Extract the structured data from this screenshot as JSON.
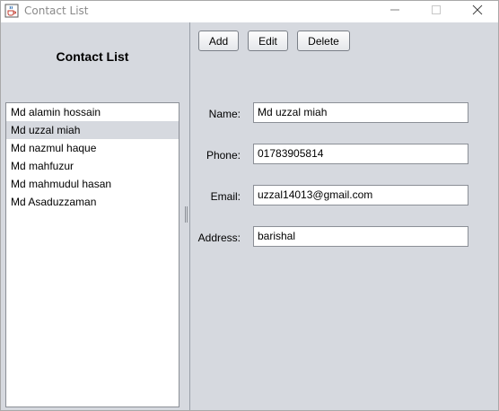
{
  "window": {
    "title": "Contact List"
  },
  "left": {
    "heading": "Contact List",
    "contacts": [
      "Md alamin hossain",
      "Md uzzal miah",
      "Md nazmul haque",
      "Md mahfuzur",
      "Md mahmudul hasan",
      "Md Asaduzzaman"
    ],
    "selected_index": 1
  },
  "toolbar": {
    "add_label": "Add",
    "edit_label": "Edit",
    "delete_label": "Delete"
  },
  "form": {
    "name_label": "Name:",
    "name_value": "Md uzzal miah",
    "phone_label": "Phone:",
    "phone_value": "01783905814",
    "email_label": "Email:",
    "email_value": "uzzal14013@gmail.com",
    "address_label": "Address:",
    "address_value": "barishal"
  },
  "icons": {
    "app": "java-cup-icon",
    "minimize": "minimize-icon",
    "maximize": "maximize-icon",
    "close": "close-icon"
  }
}
